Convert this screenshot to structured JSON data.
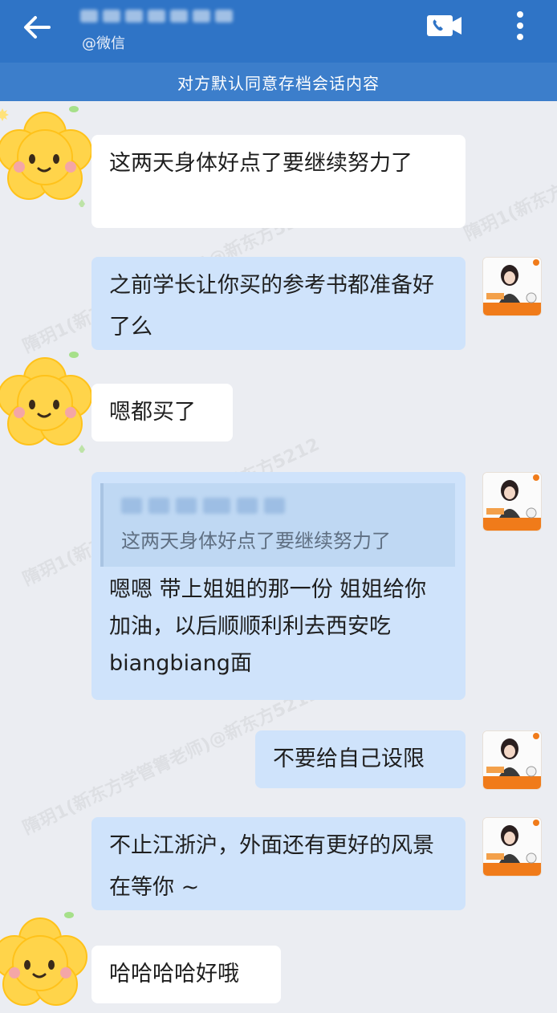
{
  "header": {
    "subtitle": "@微信",
    "back_icon": "arrow-left-icon",
    "video_icon": "video-call-icon",
    "more_icon": "more-vertical-icon"
  },
  "notice": "对方默认同意存档会话内容",
  "watermark_text": "隋玥1(新东方学管箐老师)@新东方5212",
  "messages": [
    {
      "side": "left",
      "text": "这两天身体好点了要继续努力了"
    },
    {
      "side": "right",
      "text": "之前学长让你买的参考书都准备好了么"
    },
    {
      "side": "left",
      "text": "嗯都买了"
    },
    {
      "side": "right",
      "quote": "这两天身体好点了要继续努力了",
      "text": "嗯嗯 带上姐姐的那一份 姐姐给你加油，以后顺顺利利去西安吃biangbiang面"
    },
    {
      "side": "right",
      "text": "不要给自己设限"
    },
    {
      "side": "right",
      "text": "不止江浙沪，外面还有更好的风景在等你 ~"
    },
    {
      "side": "left",
      "text": "哈哈哈哈好哦"
    }
  ],
  "colors": {
    "header_bg": "#2f74c6",
    "notice_bg": "#3c7ecb",
    "chat_bg": "#ebedf2",
    "bubble_left": "#ffffff",
    "bubble_right": "#cfe3fb"
  }
}
